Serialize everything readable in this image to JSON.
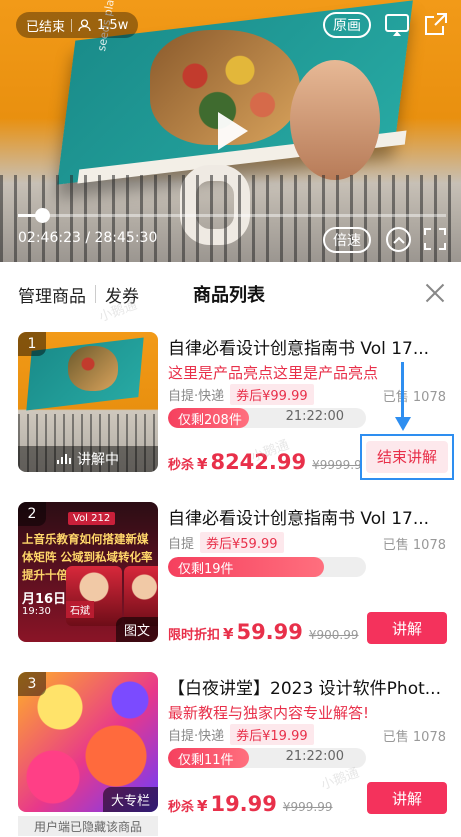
{
  "player": {
    "status": "已结束",
    "viewers": "1.5w",
    "origin_label": "原画",
    "time": "02:46:23 / 28:45:30",
    "progress": 0.057,
    "speed_label": "倍速",
    "cover_text": "seeds planted in concrete"
  },
  "panel": {
    "tab_manage": "管理商品",
    "tab_coupon": "发券",
    "title": "商品列表",
    "watermark": "小鹅通",
    "hidden_note": "用户端已隐藏该商品"
  },
  "items": [
    {
      "index": "1",
      "name": "自律必看设计创意指南书 Vol 17...",
      "highlight": "这里是产品亮点这里是产品亮点",
      "shipping": "自提·快递",
      "coupon": "券后¥99.99",
      "sold": "已售 1078",
      "stock": "仅剩208件",
      "stock_ratio": 0.41,
      "stock_time": "21:22:00",
      "price_label": "秒杀",
      "price_currency": "¥",
      "price": "8242.99",
      "old_price": "¥9999.99",
      "thumb_status": "讲解中",
      "action": "结束讲解"
    },
    {
      "index": "2",
      "name": "自律必看设计创意指南书 Vol 17...",
      "shipping": "自提",
      "coupon": "券后¥59.99",
      "sold": "已售 1078",
      "stock": "仅剩19件",
      "stock_ratio": 0.79,
      "price_label": "限时折扣",
      "price_currency": "¥",
      "price": "59.99",
      "old_price": "¥900.99",
      "thumb_tag": "图文",
      "thumb_title": "上音乐教育如何搭建新媒体矩阵 公域到私域转化率提升十倍",
      "thumb_badge": "Vol 212",
      "thumb_date": "月16日",
      "thumb_time": "19:30",
      "thumb_speaker": "石斌",
      "action": "讲解"
    },
    {
      "index": "3",
      "name": "【白夜讲堂】2023 设计软件Phot...",
      "highlight": "最新教程与独家内容专业解答!",
      "shipping": "自提·快递",
      "coupon": "券后¥19.99",
      "sold": "已售 1078",
      "stock": "仅剩11件",
      "stock_ratio": 0.41,
      "stock_time": "21:22:00",
      "price_label": "秒杀",
      "price_currency": "¥",
      "price": "19.99",
      "old_price": "¥999.99",
      "thumb_tag": "大专栏",
      "action": "讲解"
    }
  ]
}
